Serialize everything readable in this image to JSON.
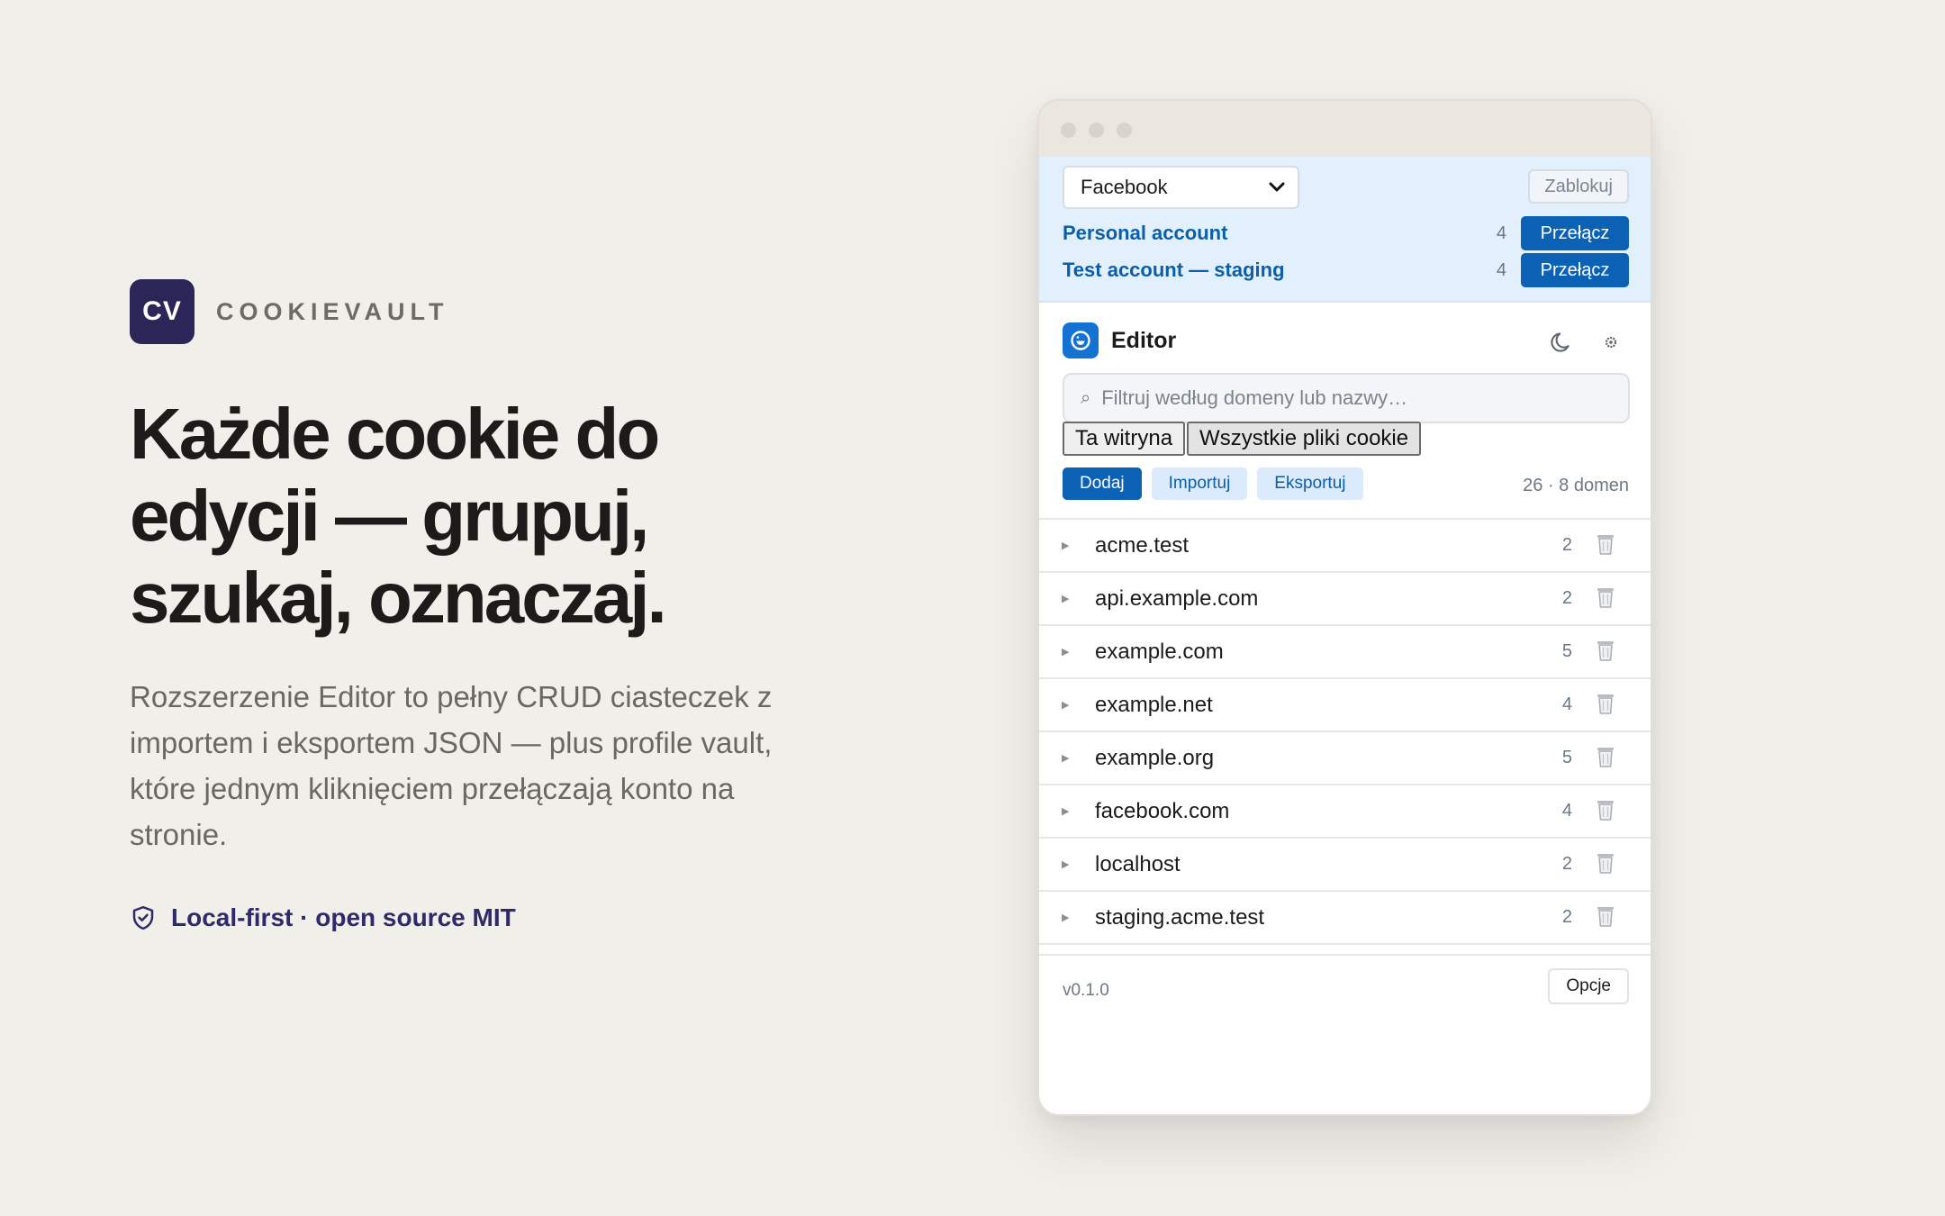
{
  "brand": {
    "logo_text": "CV",
    "name": "COOKIEVAULT"
  },
  "hero": {
    "headline": "Każde cookie do edycji — grupuj, szukaj, oznaczaj.",
    "lead": "Rozszerzenie Editor to pełny CRUD ciasteczek z importem i eksportem JSON — plus profile vault, które jednym kliknięciem przełączają konto na stronie.",
    "badge": "Local-first · open source MIT",
    "badge_icon": "shield-check-icon"
  },
  "vault": {
    "site_select": "Facebook",
    "block_label": "Zablokuj",
    "profiles": [
      {
        "name": "Personal account",
        "count": "4",
        "switch_label": "Przełącz"
      },
      {
        "name": "Test account — staging",
        "count": "4",
        "switch_label": "Przełącz"
      }
    ]
  },
  "editor": {
    "title": "Editor",
    "theme_icon": "moon-icon",
    "settings_icon": "gear-icon",
    "search_placeholder": "Filtruj według domeny lub nazwy…",
    "scope_buttons": [
      "Ta witryna",
      "Wszystkie pliki cookie"
    ],
    "actions": {
      "add": "Dodaj",
      "import": "Importuj",
      "export": "Eksportuj"
    },
    "summary": "26 · 8 domen",
    "domains": [
      {
        "name": "acme.test",
        "count": "2"
      },
      {
        "name": "api.example.com",
        "count": "2"
      },
      {
        "name": "example.com",
        "count": "5"
      },
      {
        "name": "example.net",
        "count": "4"
      },
      {
        "name": "example.org",
        "count": "5"
      },
      {
        "name": "facebook.com",
        "count": "4"
      },
      {
        "name": "localhost",
        "count": "2"
      },
      {
        "name": "staging.acme.test",
        "count": "2"
      }
    ],
    "version": "v0.1.0",
    "options_label": "Opcje"
  },
  "colors": {
    "background": "#f1efea",
    "brand": "#2c2558",
    "accent": "#0b62b5",
    "vault_bg": "#e2effc"
  }
}
